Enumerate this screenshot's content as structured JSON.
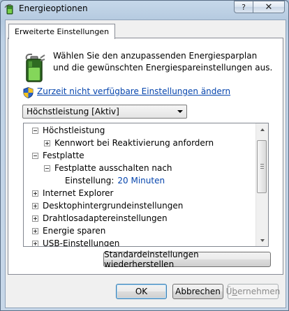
{
  "window": {
    "title": "Energieoptionen",
    "help_label": "?",
    "close_label": "✕"
  },
  "tab": {
    "label": "Erweiterte Einstellungen"
  },
  "description": "Wählen Sie den anzupassenden Energiesparplan und die gewünschten Energiespareinstellungen aus.",
  "change_link": "Zurzeit nicht verfügbare Einstellungen ändern",
  "plan_select": {
    "value": "Höchstleistung [Aktiv]"
  },
  "tree": {
    "rows": [
      {
        "label": "Höchstleistung",
        "expander": "minus",
        "indent": 0
      },
      {
        "label": "Kennwort bei Reaktivierung anfordern",
        "expander": "plus",
        "indent": 1
      },
      {
        "label": "Festplatte",
        "expander": "minus",
        "indent": 0
      },
      {
        "label": "Festplatte ausschalten nach",
        "expander": "minus",
        "indent": 1
      },
      {
        "label": "Einstellung:",
        "value": "20 Minuten",
        "expander": "none",
        "indent": 2
      },
      {
        "label": "Internet Explorer",
        "expander": "plus",
        "indent": 0
      },
      {
        "label": "Desktophintergrundeinstellungen",
        "expander": "plus",
        "indent": 0
      },
      {
        "label": "Drahtlosadaptereinstellungen",
        "expander": "plus",
        "indent": 0
      },
      {
        "label": "Energie sparen",
        "expander": "plus",
        "indent": 0
      },
      {
        "label": "USB-Einstellungen",
        "expander": "plus",
        "indent": 0
      }
    ]
  },
  "buttons": {
    "restore": "Standardeinstellungen wiederherstellen",
    "ok": "OK",
    "cancel": "Abbrechen",
    "apply_prefix": "Ü",
    "apply_underlined": "b",
    "apply_suffix": "ernehmen"
  },
  "icons": {
    "title": "battery-plug-icon",
    "battery": "battery-icon",
    "shield": "uac-shield-icon",
    "expand": "plus-expander-icon",
    "collapse": "minus-expander-icon"
  }
}
